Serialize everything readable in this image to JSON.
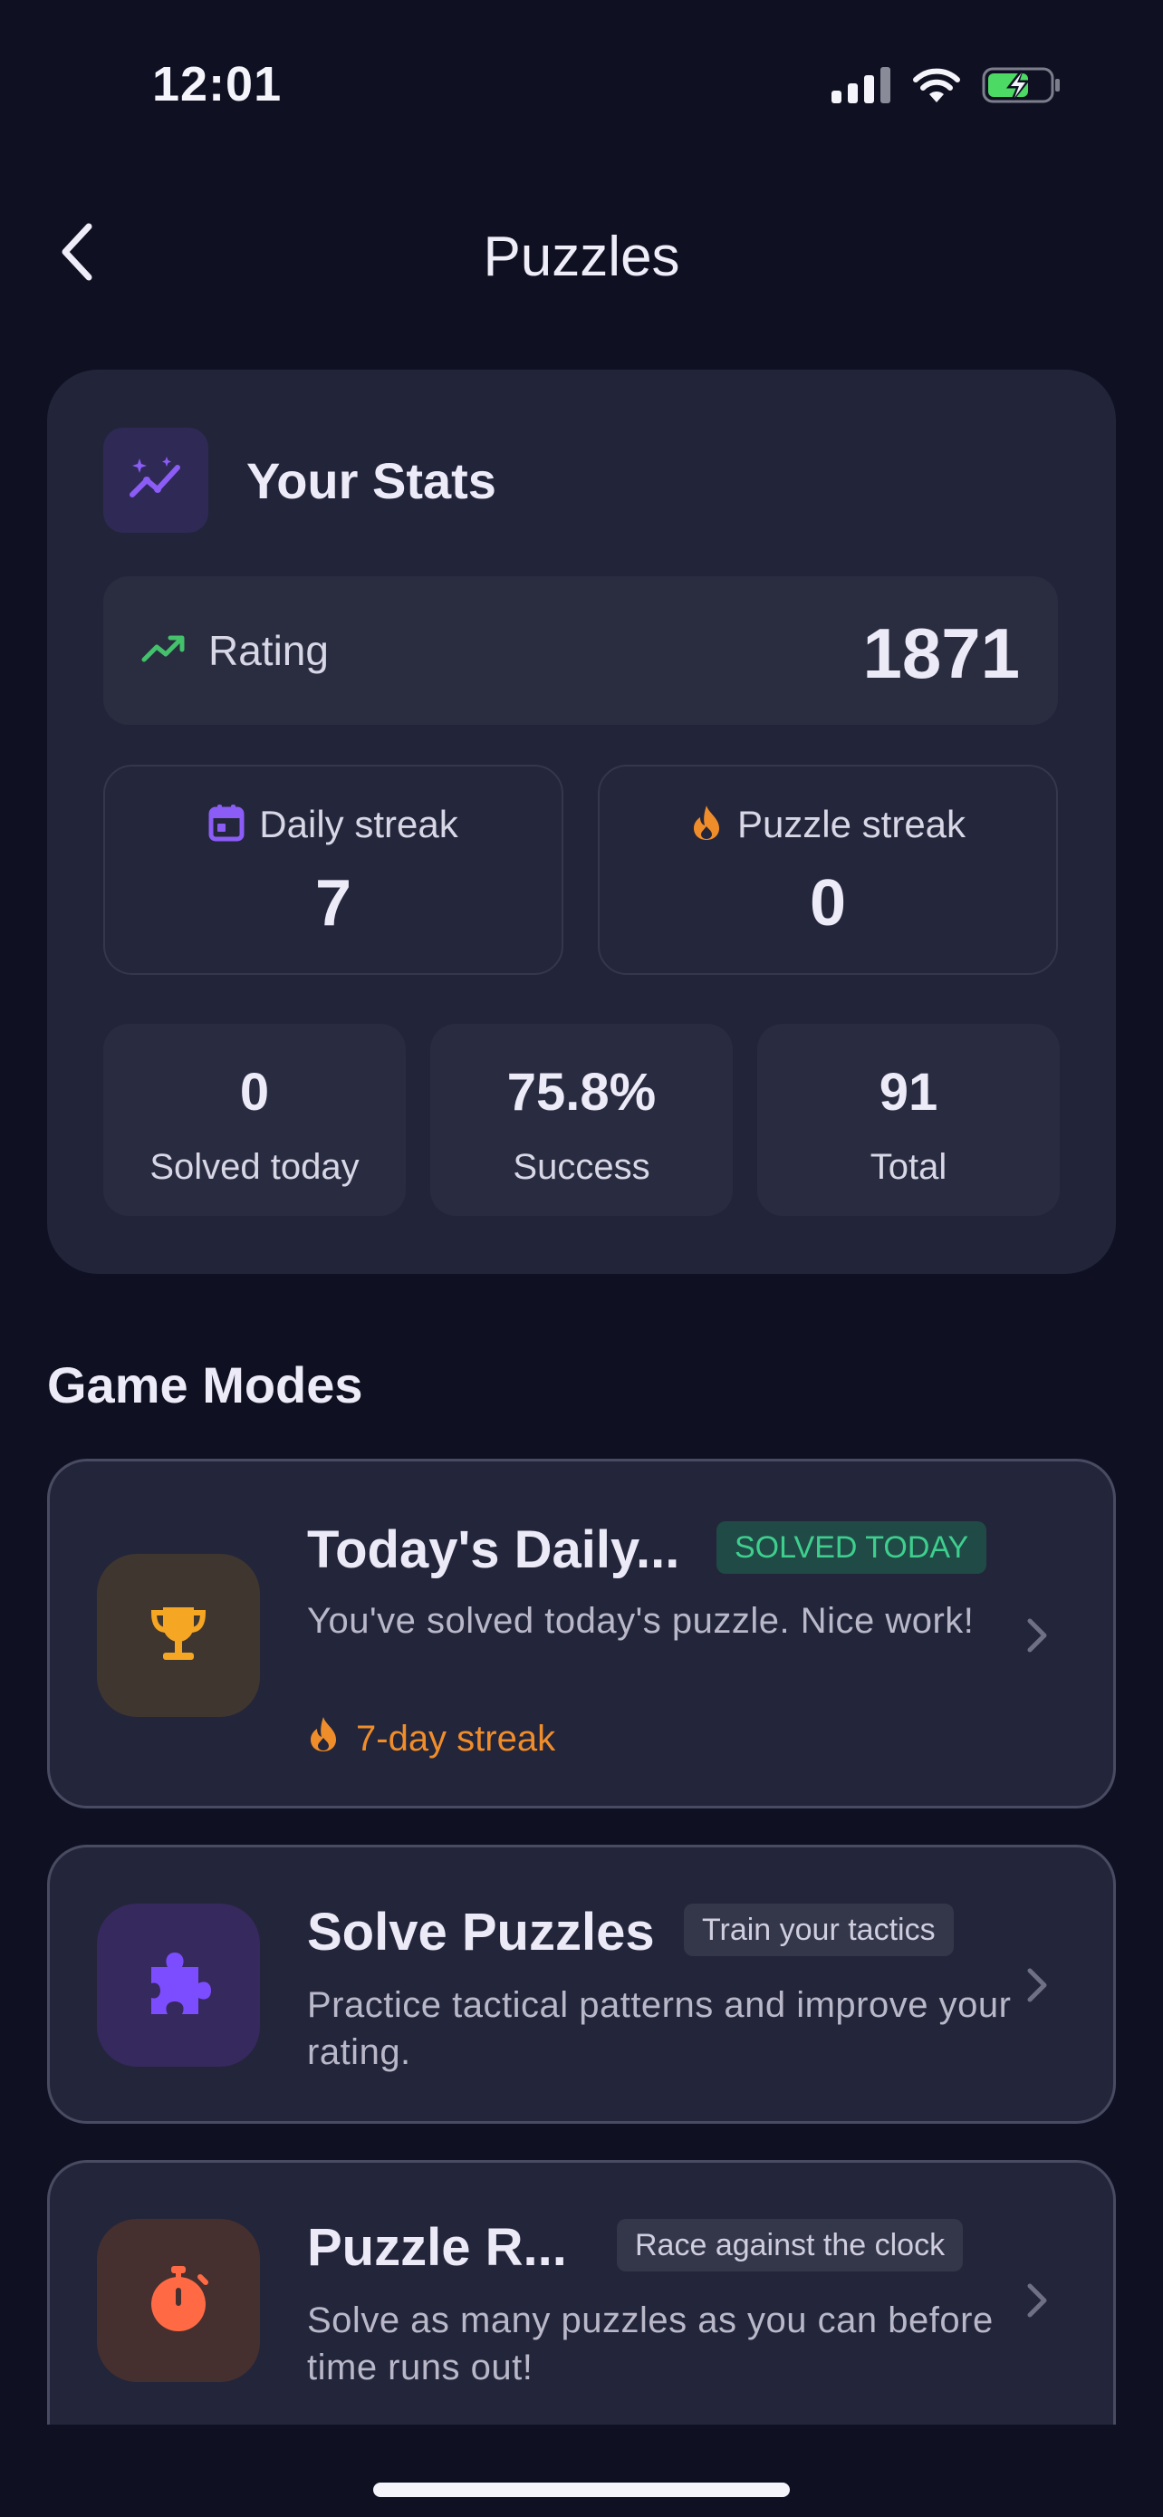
{
  "status_bar": {
    "time": "12:01",
    "icons": [
      "signal-icon",
      "wifi-icon",
      "battery-charging-icon"
    ]
  },
  "nav": {
    "title": "Puzzles",
    "back_icon": "chevron-left-icon"
  },
  "stats": {
    "title": "Your Stats",
    "icon": "trending-sparkle-icon",
    "rating": {
      "label": "Rating",
      "value": "1871",
      "icon": "trending-up-icon"
    },
    "daily_streak": {
      "label": "Daily streak",
      "value": "7",
      "icon": "calendar-icon"
    },
    "puzzle_streak": {
      "label": "Puzzle streak",
      "value": "0",
      "icon": "flame-icon"
    },
    "solved_today": {
      "value": "0",
      "label": "Solved today"
    },
    "success": {
      "value": "75.8%",
      "label": "Success"
    },
    "total": {
      "value": "91",
      "label": "Total"
    }
  },
  "game_modes": {
    "title": "Game Modes",
    "items": [
      {
        "title": "Today's Daily...",
        "badge": "SOLVED TODAY",
        "description": "You've solved today's puzzle. Nice work!",
        "streak": "7-day streak",
        "icon": "trophy-icon"
      },
      {
        "title": "Solve Puzzles",
        "badge": "Train your tactics",
        "description": "Practice tactical patterns and improve your rating.",
        "icon": "puzzle-piece-icon"
      },
      {
        "title": "Puzzle R...",
        "badge": "Race against the clock",
        "description": "Solve as many puzzles as you can before time runs out!",
        "icon": "stopwatch-icon"
      }
    ]
  },
  "colors": {
    "background": "#0f1123",
    "card": "#22243a",
    "accent_purple": "#7c4dff",
    "accent_green": "#3ecf8e",
    "accent_orange": "#f08d2b",
    "accent_red": "#ff6a45"
  }
}
